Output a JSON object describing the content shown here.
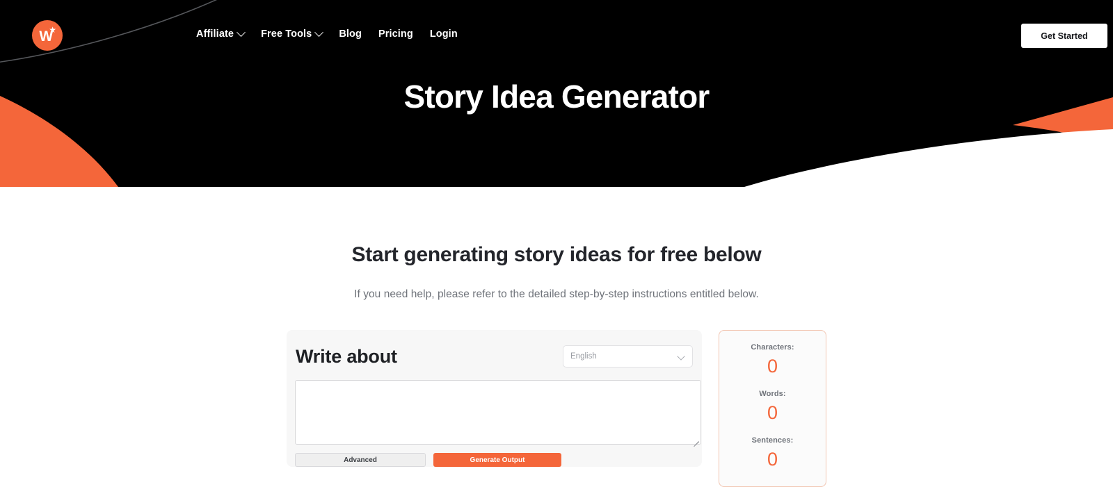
{
  "brand": {
    "logo_letter": "W",
    "logo_star": "★",
    "accent_color": "#f4663a",
    "hero_bg_color": "#000000"
  },
  "nav": {
    "items": [
      {
        "label": "Affiliate",
        "has_dropdown": true
      },
      {
        "label": "Free Tools",
        "has_dropdown": true
      },
      {
        "label": "Blog",
        "has_dropdown": false
      },
      {
        "label": "Pricing",
        "has_dropdown": false
      },
      {
        "label": "Login",
        "has_dropdown": false
      }
    ],
    "cta_label": "Get Started"
  },
  "hero": {
    "title": "Story Idea Generator"
  },
  "main": {
    "heading": "Start generating story ideas for free below",
    "subheading": "If you need help, please refer to the detailed step-by-step instructions entitled below."
  },
  "form": {
    "title": "Write about",
    "language": {
      "selected": "English",
      "placeholder": "English",
      "options": [
        "English"
      ]
    },
    "input": {
      "value": "",
      "placeholder": ""
    },
    "advanced_label": "Advanced",
    "generate_label": "Generate Output"
  },
  "stats": {
    "items": [
      {
        "label": "Characters:",
        "value": "0"
      },
      {
        "label": "Words:",
        "value": "0"
      },
      {
        "label": "Sentences:",
        "value": "0"
      }
    ]
  }
}
